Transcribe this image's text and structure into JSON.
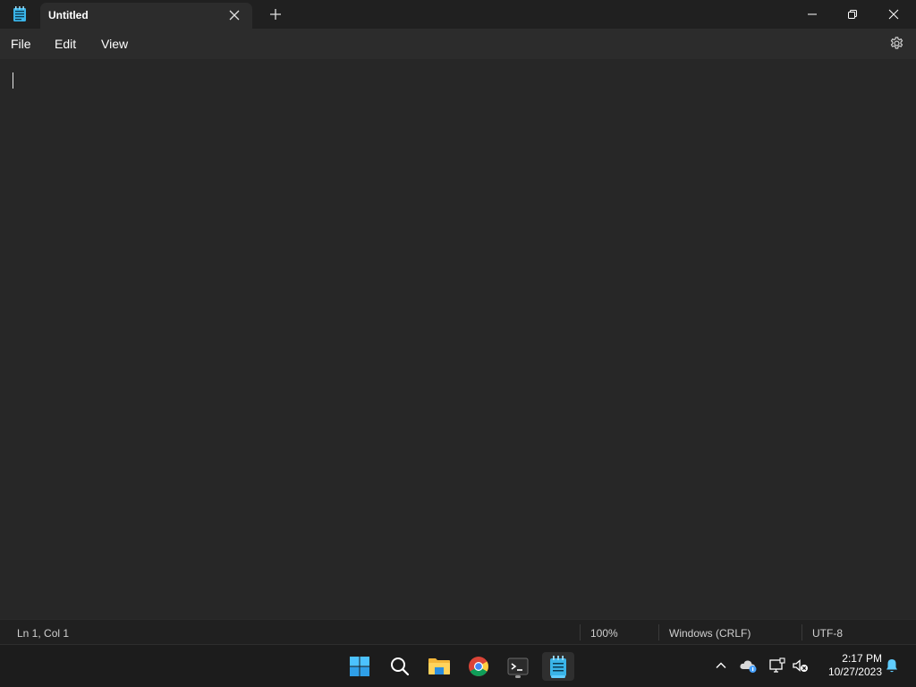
{
  "window": {
    "tab_title": "Untitled"
  },
  "menu": {
    "items": [
      "File",
      "Edit",
      "View"
    ]
  },
  "editor": {
    "content": ""
  },
  "status": {
    "position": "Ln 1, Col 1",
    "zoom": "100%",
    "line_ending": "Windows (CRLF)",
    "encoding": "UTF-8"
  },
  "taskbar": {
    "apps": [
      "start-icon",
      "search-icon",
      "file-explorer-icon",
      "chrome-icon",
      "terminal-icon",
      "notepad-icon"
    ],
    "clock_time": "2:17 PM",
    "clock_date": "10/27/2023"
  },
  "colors": {
    "accent": "#60cdff",
    "titlebar": "#202020",
    "editor_bg": "#272727",
    "menubar": "#2c2c2c"
  }
}
